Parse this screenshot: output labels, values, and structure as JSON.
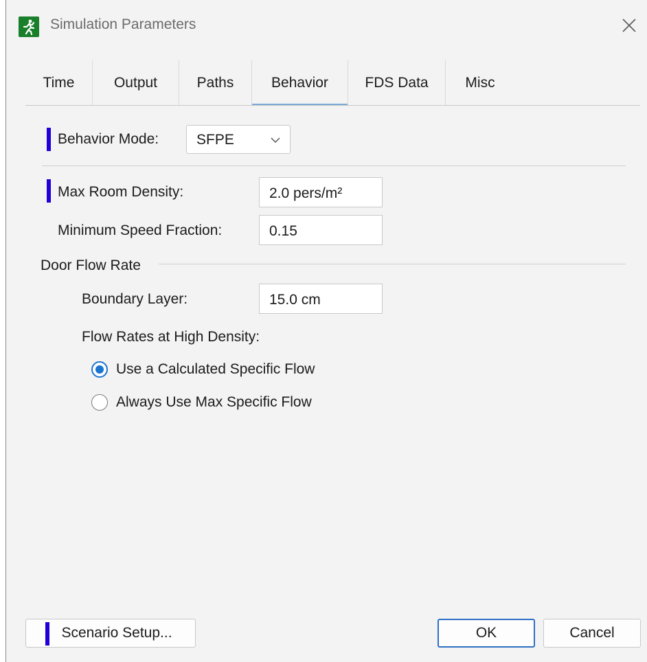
{
  "window": {
    "title": "Simulation Parameters"
  },
  "tabs": [
    {
      "label": "Time",
      "active": false
    },
    {
      "label": "Output",
      "active": false
    },
    {
      "label": "Paths",
      "active": false
    },
    {
      "label": "Behavior",
      "active": true
    },
    {
      "label": "FDS Data",
      "active": false
    },
    {
      "label": "Misc",
      "active": false
    }
  ],
  "behavior": {
    "mode_label": "Behavior Mode:",
    "mode_value": "SFPE",
    "max_density_label": "Max Room Density:",
    "max_density_value": "2.0 pers/m²",
    "min_speed_label": "Minimum Speed Fraction:",
    "min_speed_value": "0.15"
  },
  "door_flow": {
    "group_label": "Door Flow Rate",
    "boundary_label": "Boundary Layer:",
    "boundary_value": "15.0 cm",
    "high_density_label": "Flow Rates at High Density:",
    "options": [
      {
        "label": "Use a Calculated Specific Flow",
        "checked": true
      },
      {
        "label": "Always Use Max Specific Flow",
        "checked": false
      }
    ]
  },
  "footer": {
    "scenario_button": "Scenario Setup...",
    "ok_button": "OK",
    "cancel_button": "Cancel"
  },
  "colors": {
    "marker": "#2000d9",
    "accent": "#1a74d1",
    "tab_underline": "#7aa9d6",
    "app_icon": "#1a7f2a"
  },
  "icons": {
    "app": "running-man-icon",
    "close": "close-icon",
    "dropdown": "chevron-down-icon"
  }
}
